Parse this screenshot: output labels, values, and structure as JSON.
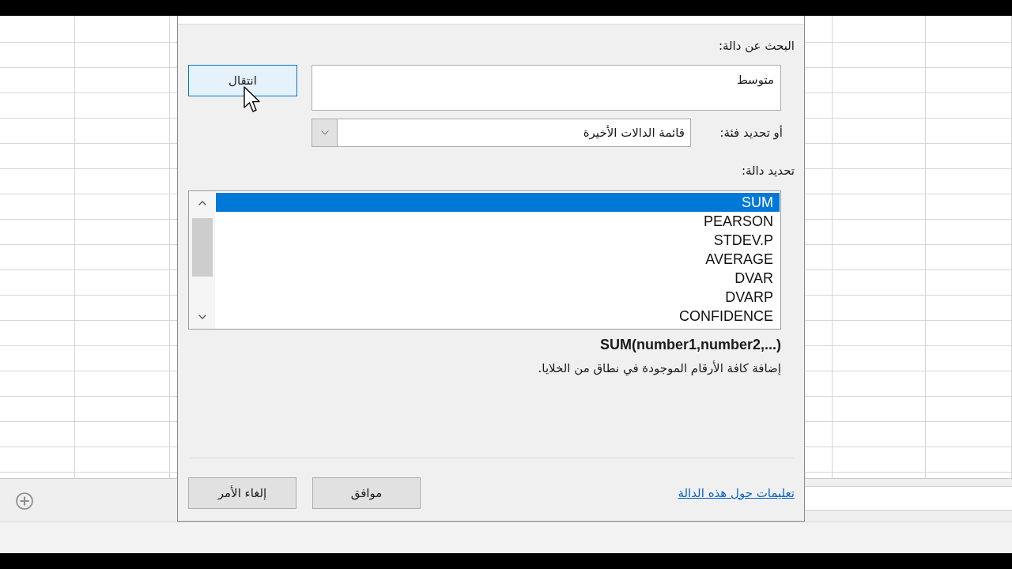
{
  "dialog": {
    "search_label": "البحث عن دالة:",
    "search_field": {
      "value": "متوسط"
    },
    "go_button": {
      "label": "انتقال",
      "hovered": true
    },
    "category_label": "أو تحديد فئة:",
    "category_select": {
      "value": "قائمة الدالات الأخيرة"
    },
    "function_label": "تحديد دالة:",
    "functions": [
      {
        "name": "SUM",
        "selected": true
      },
      {
        "name": "PEARSON",
        "selected": false
      },
      {
        "name": "STDEV.P",
        "selected": false
      },
      {
        "name": "AVERAGE",
        "selected": false
      },
      {
        "name": "DVAR",
        "selected": false
      },
      {
        "name": "DVARP",
        "selected": false
      },
      {
        "name": "CONFIDENCE",
        "selected": false
      }
    ],
    "signature": "SUM(number1,number2,...)",
    "description": "إضافة كافة الأرقام الموجودة في نطاق من الخلايا.",
    "help_link": "تعليمات حول هذه الدالة",
    "buttons": [
      "موافق",
      "إلغاء الأمر"
    ]
  }
}
